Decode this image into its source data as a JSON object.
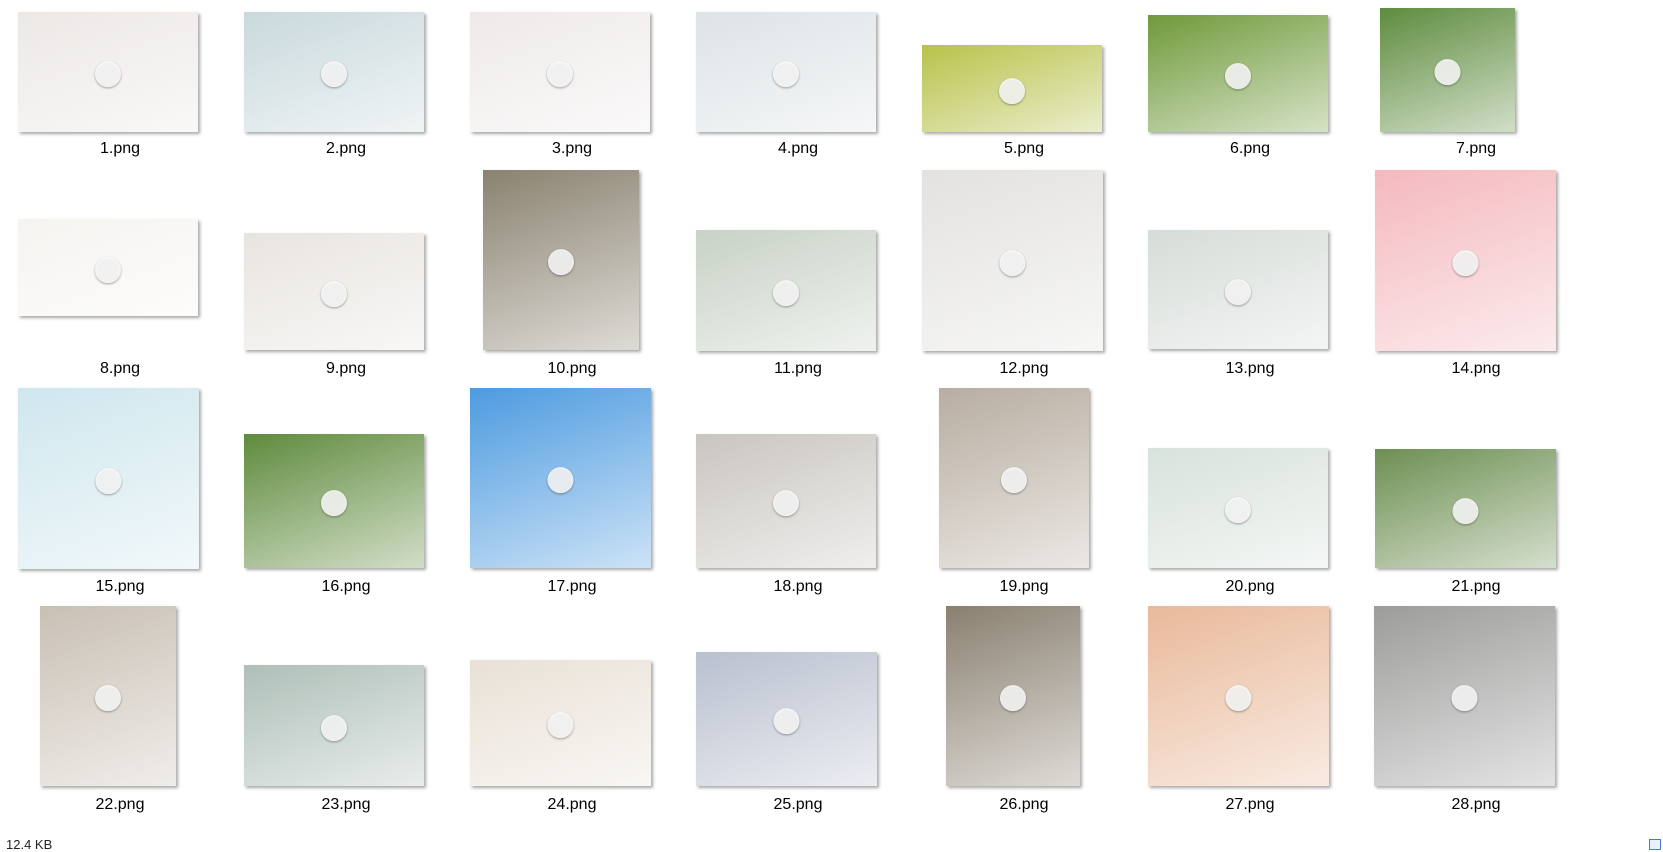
{
  "files": [
    {
      "name": "1.png",
      "color": "#ece8e6",
      "icon": "dog-icon"
    },
    {
      "name": "2.png",
      "color": "#c9d9dc",
      "icon": "dog-icon"
    },
    {
      "name": "3.png",
      "color": "#efeaea",
      "icon": "dog-icon"
    },
    {
      "name": "4.png",
      "color": "#dde3e6",
      "icon": "dog-icon"
    },
    {
      "name": "5.png",
      "color": "#b8c24a",
      "icon": "dog-icon"
    },
    {
      "name": "6.png",
      "color": "#6f9a3a",
      "icon": "dog-icon"
    },
    {
      "name": "7.png",
      "color": "#5e8c3e",
      "icon": "dog-icon"
    },
    {
      "name": "8.png",
      "color": "#f6f4f1",
      "icon": "dog-icon"
    },
    {
      "name": "9.png",
      "color": "#e8e4e0",
      "icon": "dog-icon"
    },
    {
      "name": "10.png",
      "color": "#8a8270",
      "icon": "dog-icon"
    },
    {
      "name": "11.png",
      "color": "#c8d2c6",
      "icon": "dog-icon"
    },
    {
      "name": "12.png",
      "color": "#e3e2e0",
      "icon": "dog-icon"
    },
    {
      "name": "13.png",
      "color": "#d6dcd8",
      "icon": "dog-icon"
    },
    {
      "name": "14.png",
      "color": "#f4b9be",
      "icon": "dog-icon"
    },
    {
      "name": "15.png",
      "color": "#cfe7ee",
      "icon": "dog-icon"
    },
    {
      "name": "16.png",
      "color": "#5f8b3d",
      "icon": "dog-icon"
    },
    {
      "name": "17.png",
      "color": "#4d9be0",
      "icon": "dog-icon"
    },
    {
      "name": "18.png",
      "color": "#c9c5c0",
      "icon": "dog-icon"
    },
    {
      "name": "19.png",
      "color": "#b8ada0",
      "icon": "dog-icon"
    },
    {
      "name": "20.png",
      "color": "#d8e2dc",
      "icon": "dog-icon"
    },
    {
      "name": "21.png",
      "color": "#6d8f52",
      "icon": "dog-icon"
    },
    {
      "name": "22.png",
      "color": "#c9c0b4",
      "icon": "dog-icon"
    },
    {
      "name": "23.png",
      "color": "#aebfb8",
      "icon": "dog-icon"
    },
    {
      "name": "24.png",
      "color": "#e9e1d6",
      "icon": "dog-icon"
    },
    {
      "name": "25.png",
      "color": "#b9c0cf",
      "icon": "dog-icon"
    },
    {
      "name": "26.png",
      "color": "#8a8070",
      "icon": "dog-icon"
    },
    {
      "name": "27.png",
      "color": "#e9b99a",
      "icon": "dog-icon"
    },
    {
      "name": "28.png",
      "color": "#9c9d9b",
      "icon": "dog-icon"
    }
  ],
  "status": {
    "size_text": "12.4 KB"
  },
  "accent_color": "#4a7bd0"
}
